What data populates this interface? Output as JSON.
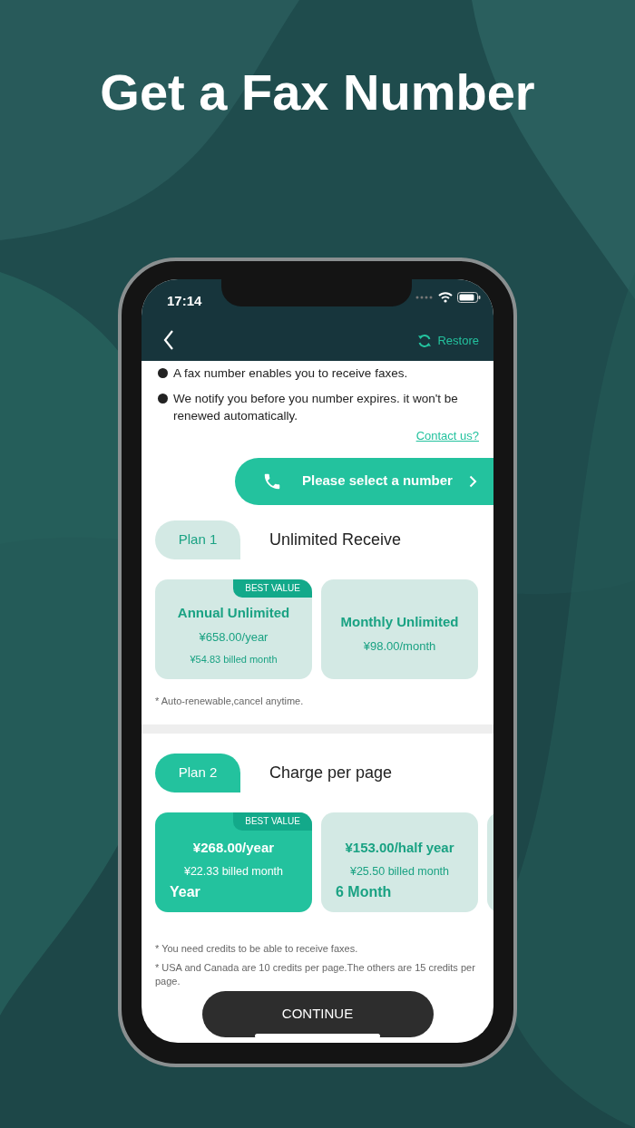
{
  "headline": "Get a Fax Number",
  "status_bar": {
    "time": "17:14"
  },
  "nav": {
    "restore": "Restore"
  },
  "info": [
    "A fax number enables you to receive faxes.",
    "We notify you before you number expires. it won't be renewed automatically."
  ],
  "contact_link": "Contact us?",
  "select_number_button": "Please select a number",
  "plans": [
    {
      "tab": "Plan 1",
      "title": "Unlimited Receive",
      "selected": false,
      "options": [
        {
          "title": "Annual Unlimited",
          "price": "¥658.00/year",
          "billed": "¥54.83 billed month",
          "badge": "BEST VALUE",
          "selected": false
        },
        {
          "title": "Monthly Unlimited",
          "price": "¥98.00/month",
          "selected": false
        }
      ],
      "notes": [
        "* Auto-renewable,cancel anytime."
      ]
    },
    {
      "tab": "Plan 2",
      "title": "Charge per page",
      "selected": true,
      "options": [
        {
          "price": "¥268.00/year",
          "billed": "¥22.33 billed month",
          "period": "Year",
          "badge": "BEST VALUE",
          "selected": true
        },
        {
          "price": "¥153.00/half year",
          "billed": "¥25.50 billed month",
          "period": "6 Month",
          "selected": false
        }
      ],
      "notes": [
        "* You need credits to be able to receive faxes.",
        "* USA and Canada are 10 credits per page.The others are 15 credits per page."
      ]
    }
  ],
  "continue_button": "CONTINUE"
}
